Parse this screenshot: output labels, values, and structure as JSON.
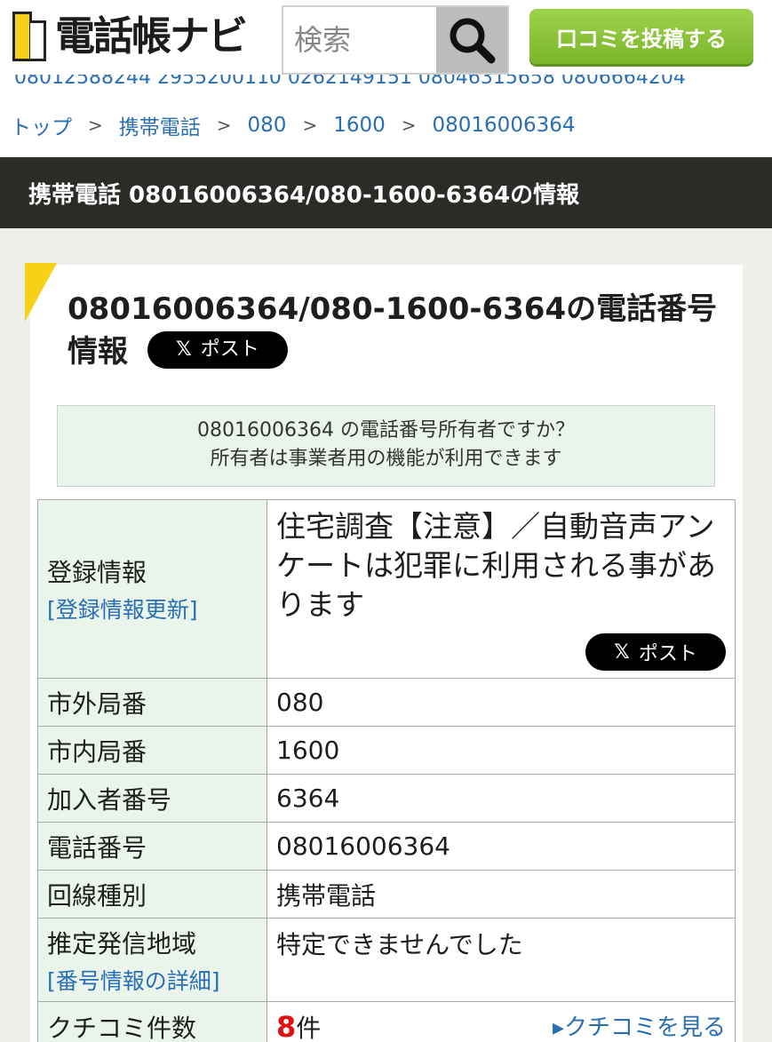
{
  "header": {
    "logo_text": "電話帳ナビ",
    "search_placeholder": "検索",
    "post_button": "口コミを投稿する"
  },
  "ticker_text": "08012588244 2955200110 0262149151 08046315658 0806664204",
  "breadcrumb": [
    "トップ",
    "携帯電話",
    "080",
    "1600",
    "08016006364"
  ],
  "breadcrumb_sep": ">",
  "page_title": "携帯電話 08016006364/080-1600-6364の情報",
  "card": {
    "title": "08016006364/080-1600-6364の電話番号情報",
    "x_glyph": "𝕏",
    "x_post_label": "ポスト",
    "owner_line1": "08016006364 の電話番号所有者ですか？",
    "owner_line2": "所有者は事業者用の機能が利用できます"
  },
  "table": {
    "registration": {
      "key": "登録情報",
      "key_link": "[登録情報更新]",
      "value": "住宅調査【注意】／自動音声アンケートは犯罪に利用される事があります"
    },
    "area_code": {
      "key": "市外局番",
      "value": "080"
    },
    "local_code": {
      "key": "市内局番",
      "value": "1600"
    },
    "subscriber": {
      "key": "加入者番号",
      "value": "6364"
    },
    "phone": {
      "key": "電話番号",
      "value": "08016006364"
    },
    "line_type": {
      "key": "回線種別",
      "value": "携帯電話"
    },
    "region": {
      "key": "推定発信地域",
      "key_link": "[番号情報の詳細]",
      "value": "特定できませんでした"
    },
    "reviews": {
      "key": "クチコミ件数",
      "count": "8",
      "unit": "件",
      "see_link": "▸クチコミを見る"
    }
  },
  "colors": {
    "accent_yellow": "#f7d117",
    "green_button": "#86c036",
    "link_blue": "#2a6fb5",
    "title_bar": "#2b2b27",
    "count_red": "#e01010"
  }
}
